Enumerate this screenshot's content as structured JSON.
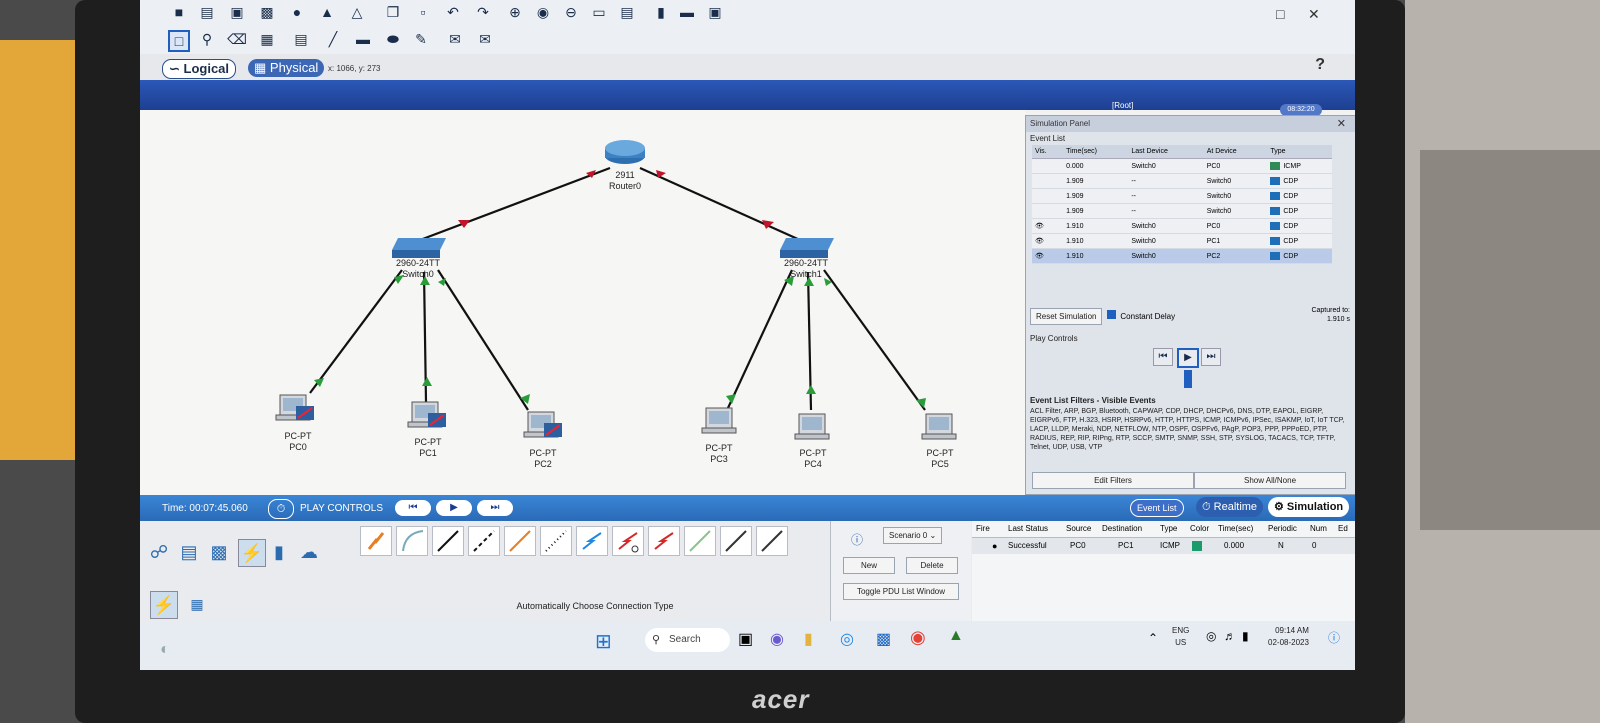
{
  "window": {
    "coords": "x: 1066, y: 273",
    "help": "?",
    "root_label": "[Root]",
    "clock_label": "08:32:20"
  },
  "tabs": {
    "logical": "Logical",
    "physical": "Physical"
  },
  "devices": {
    "router": {
      "model": "2911",
      "name": "Router0"
    },
    "switch0": {
      "model": "2960-24TT",
      "name": "Switch0"
    },
    "switch1": {
      "model": "2960-24TT",
      "name": "Switch1"
    },
    "pcs": [
      {
        "model": "PC-PT",
        "name": "PC0"
      },
      {
        "model": "PC-PT",
        "name": "PC1"
      },
      {
        "model": "PC-PT",
        "name": "PC2"
      },
      {
        "model": "PC-PT",
        "name": "PC3"
      },
      {
        "model": "PC-PT",
        "name": "PC4"
      },
      {
        "model": "PC-PT",
        "name": "PC5"
      }
    ]
  },
  "sim_panel": {
    "title": "Simulation Panel",
    "event_list_title": "Event List",
    "columns": [
      "Vis.",
      "Time(sec)",
      "Last Device",
      "At Device",
      "Type"
    ],
    "events": [
      {
        "time": "0.000",
        "last": "Switch0",
        "at": "PC0",
        "type": "ICMP"
      },
      {
        "time": "1.909",
        "last": "--",
        "at": "Switch0",
        "type": "CDP"
      },
      {
        "time": "1.909",
        "last": "--",
        "at": "Switch0",
        "type": "CDP"
      },
      {
        "time": "1.909",
        "last": "--",
        "at": "Switch0",
        "type": "CDP"
      },
      {
        "time": "1.910",
        "last": "Switch0",
        "at": "PC0",
        "type": "CDP"
      },
      {
        "time": "1.910",
        "last": "Switch0",
        "at": "PC1",
        "type": "CDP"
      },
      {
        "time": "1.910",
        "last": "Switch0",
        "at": "PC2",
        "type": "CDP"
      }
    ],
    "reset_label": "Reset Simulation",
    "constant_delay": "Constant Delay",
    "captured_to_label": "Captured to:",
    "captured_to_value": "1.910 s",
    "play_controls_title": "Play Controls",
    "filters_title": "Event List Filters - Visible Events",
    "filters_text": "ACL Filter, ARP, BGP, Bluetooth, CAPWAP, CDP, DHCP, DHCPv6, DNS, DTP, EAPOL, EIGRP, EIGRPv6, FTP, H.323, HSRP, HSRPv6, HTTP, HTTPS, ICMP, ICMPv6, IPSec, ISAKMP, IoT, IoT TCP, LACP, LLDP, Meraki, NDP, NETFLOW, NTP, OSPF, OSPFv6, PAgP, POP3, PPP, PPPoED, PTP, RADIUS, REP, RIP, RIPng, RTP, SCCP, SMTP, SNMP, SSH, STP, SYSLOG, TACACS, TCP, TFTP, Telnet, UDP, USB, VTP",
    "edit_filters": "Edit Filters",
    "show_all": "Show All/None"
  },
  "status": {
    "time": "Time: 00:07:45.060",
    "play_controls": "PLAY CONTROLS",
    "event_list": "Event List",
    "realtime": "Realtime",
    "simulation": "Simulation"
  },
  "device_bar": {
    "connection_type": "Automatically Choose Connection Type"
  },
  "pdu": {
    "scenario": "Scenario 0",
    "new": "New",
    "delete": "Delete",
    "toggle": "Toggle PDU List Window",
    "columns": [
      "Fire",
      "Last Status",
      "Source",
      "Destination",
      "Type",
      "Color",
      "Time(sec)",
      "Periodic",
      "Num",
      "Ed"
    ],
    "row": {
      "status": "Successful",
      "source": "PC0",
      "dest": "PC1",
      "type": "ICMP",
      "time": "0.000",
      "periodic": "N",
      "num": "0"
    }
  },
  "taskbar": {
    "search": "Search",
    "lang1": "ENG",
    "lang2": "US",
    "time": "09:14 AM",
    "date": "02-08-2023"
  },
  "brand": "acer"
}
